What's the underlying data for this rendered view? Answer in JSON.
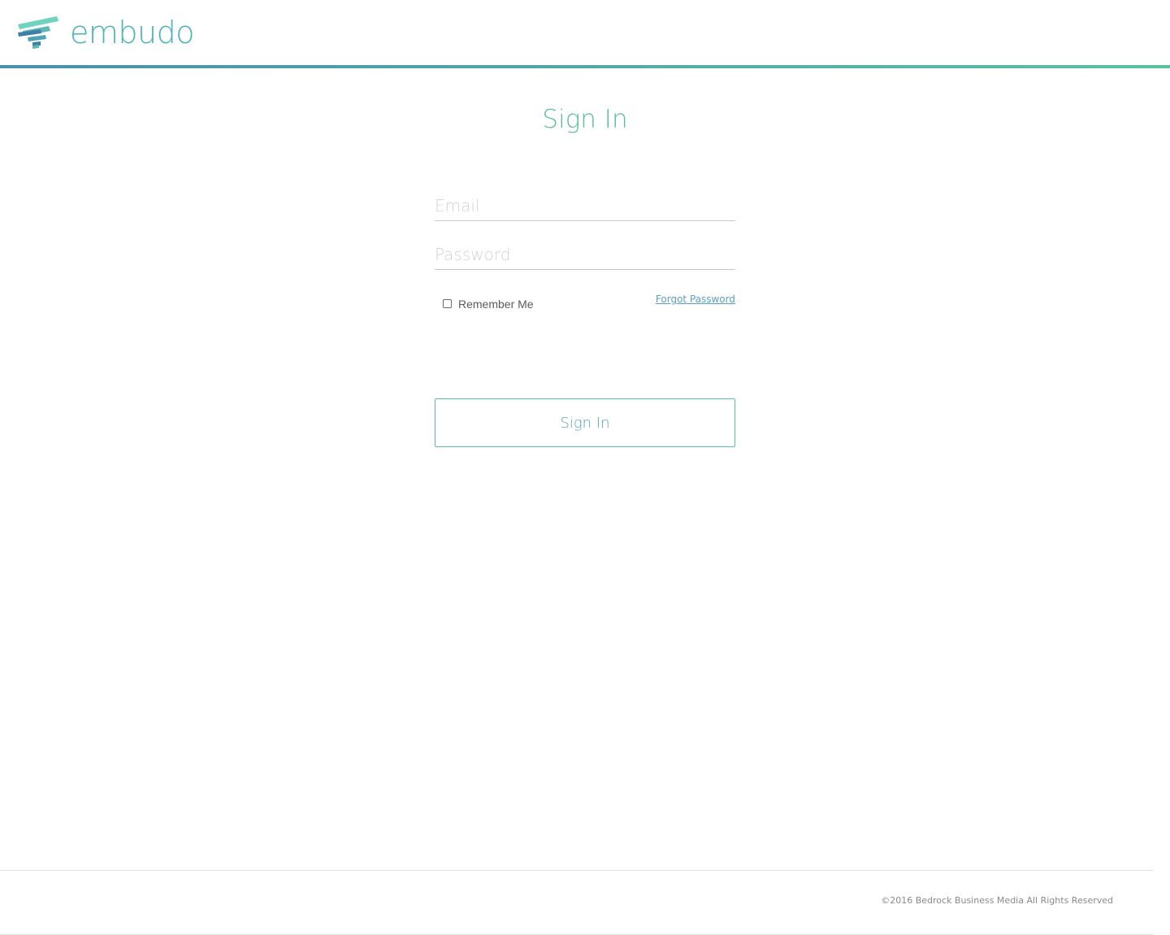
{
  "brand": {
    "name": "embudo",
    "text_color": "#4ab4b5",
    "accent_gradient": [
      "#4a8fb0",
      "#5bc1a0"
    ]
  },
  "login": {
    "title": "Sign In",
    "email_placeholder": "Email",
    "email_value": "",
    "password_placeholder": "Password",
    "password_value": "",
    "remember_label": "Remember Me",
    "remember_checked": false,
    "forgot_label": "Forgot Password",
    "submit_label": "Sign In",
    "accent_color": "#5bbf97"
  },
  "footer": {
    "copyright": "©2016 Bedrock Business Media All Rights Reserved"
  }
}
